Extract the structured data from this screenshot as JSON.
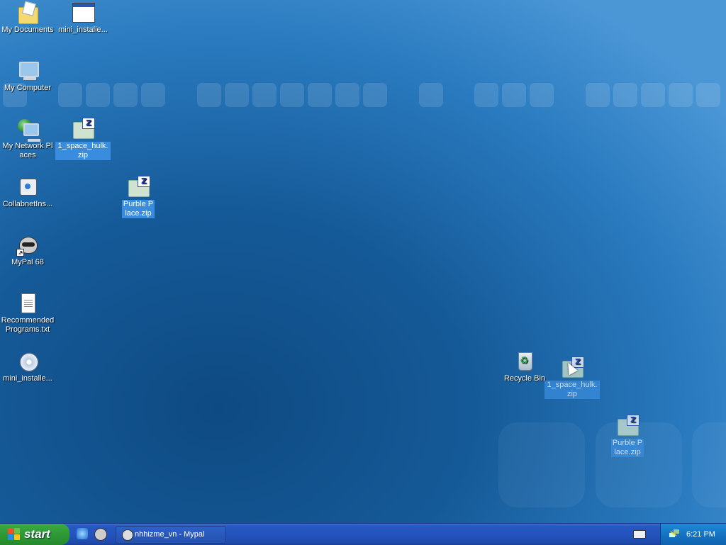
{
  "desktop": {
    "icons": [
      {
        "label": "My Documents",
        "icon": "my-documents-icon"
      },
      {
        "label": "mini_installe...",
        "icon": "window-app-icon"
      },
      {
        "label": "My Computer",
        "icon": "my-computer-icon"
      },
      {
        "label": "My Network Places",
        "icon": "network-places-icon"
      },
      {
        "label": "1_space_hulk.zip",
        "icon": "zip-file-icon"
      },
      {
        "label": "CollabnetIns...",
        "icon": "installer-icon"
      },
      {
        "label": "Purble Place.zip",
        "icon": "zip-file-icon"
      },
      {
        "label": "MyPal 68",
        "icon": "mypal-icon"
      },
      {
        "label": "Recommended Programs.txt",
        "icon": "text-file-icon"
      },
      {
        "label": "mini_installe...",
        "icon": "cd-installer-icon"
      },
      {
        "label": "Recycle Bin",
        "icon": "recycle-bin-icon"
      },
      {
        "label": "1_space_hulk.zip",
        "icon": "zip-file-icon"
      },
      {
        "label": "Purble Place.zip",
        "icon": "zip-file-icon"
      }
    ]
  },
  "taskbar": {
    "start_label": "start",
    "quicklaunch": [
      {
        "name": "internet-explorer-icon"
      },
      {
        "name": "mypal-icon"
      }
    ],
    "task": {
      "label": "nhhizme_vn - Mypal",
      "icon": "mypal-icon"
    },
    "tray": {
      "clock": "6:21 PM"
    }
  },
  "colors": {
    "start_green": "#2f9a37",
    "taskbar_blue": "#2454bd",
    "tray_blue": "#1574c4",
    "selection": "#3a8cde"
  }
}
